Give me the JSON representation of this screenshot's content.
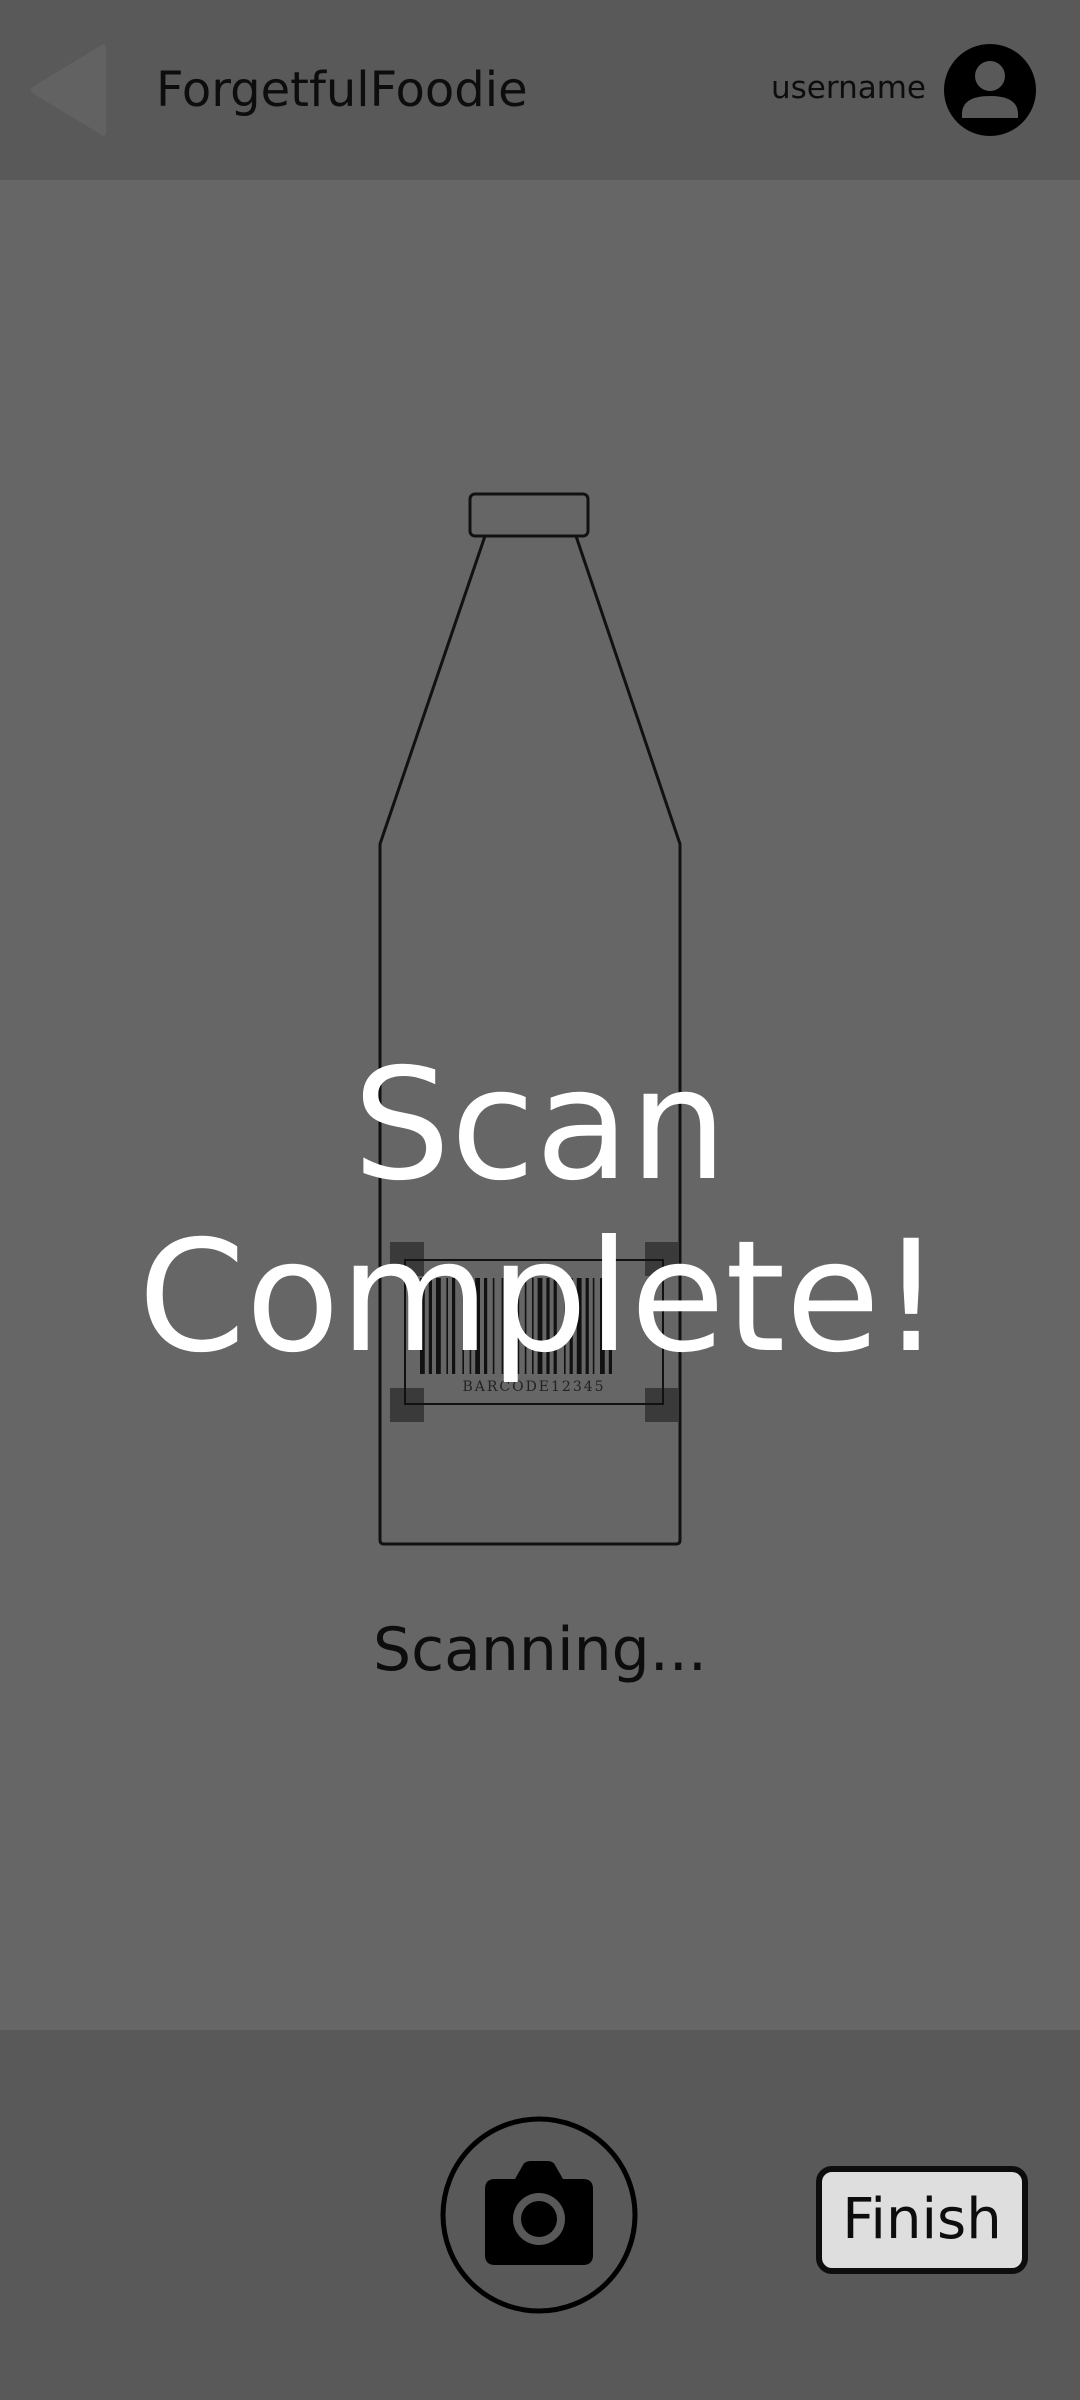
{
  "header": {
    "back_icon": "triangle-left-icon",
    "app_title": "ForgetfulFoodie",
    "username": "username",
    "avatar_icon": "user-circle-icon"
  },
  "viewfinder": {
    "subject_icon": "bottle-outline",
    "barcode": {
      "text": "BARCODE12345",
      "icon": "barcode-icon"
    },
    "overlay_message": "Scan Complete!",
    "status_text": "Scanning..."
  },
  "bottom_bar": {
    "shutter_icon": "camera-icon",
    "finish_label": "Finish"
  },
  "colors": {
    "header_bg": "#595959",
    "viewfinder_bg": "#666666",
    "bottom_bg": "#595959",
    "overlay_text": "#ffffff",
    "finish_bg": "#dedede",
    "ink": "#0d0d0d"
  }
}
